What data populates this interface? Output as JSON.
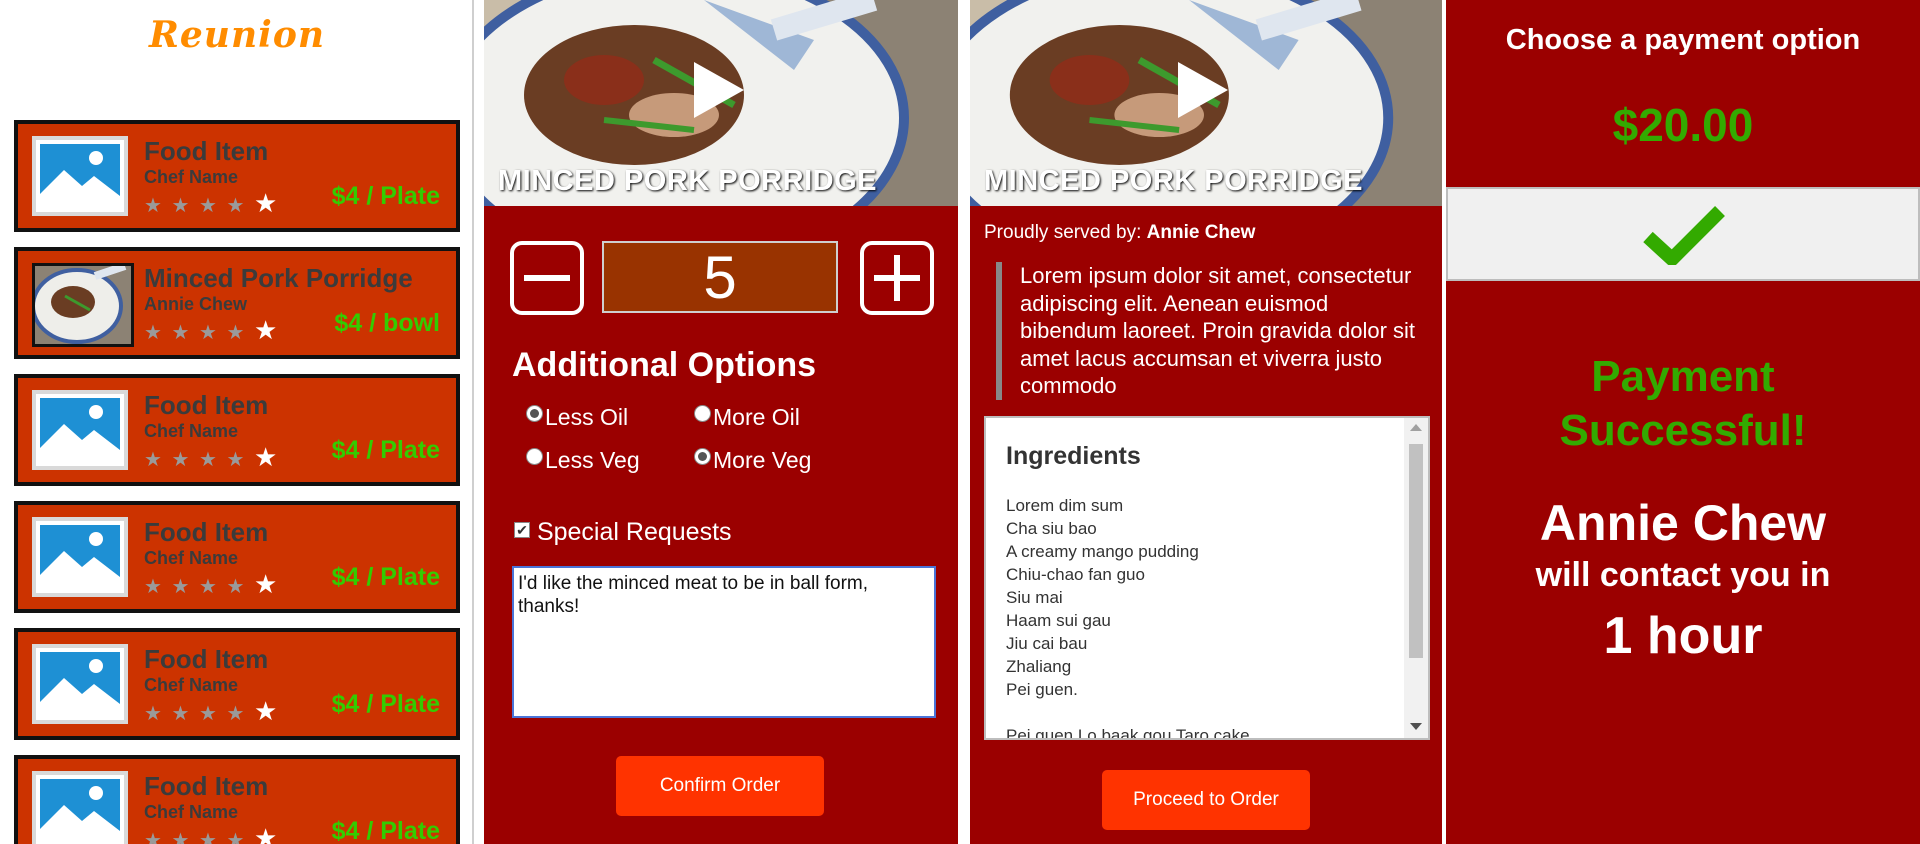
{
  "list_screen": {
    "brand": "Reunion",
    "items": [
      {
        "title": "Food Item",
        "chef": "Chef Name",
        "price": "$4 / Plate",
        "thumbnail": "image-placeholder-icon"
      },
      {
        "title": "Minced Pork Porridge",
        "chef": "Annie Chew",
        "price": "$4 / bowl",
        "thumbnail": "porridge-photo"
      },
      {
        "title": "Food Item",
        "chef": "Chef Name",
        "price": "$4 / Plate",
        "thumbnail": "image-placeholder-icon"
      },
      {
        "title": "Food Item",
        "chef": "Chef Name",
        "price": "$4 / Plate",
        "thumbnail": "image-placeholder-icon"
      },
      {
        "title": "Food Item",
        "chef": "Chef Name",
        "price": "$4 / Plate",
        "thumbnail": "image-placeholder-icon"
      },
      {
        "title": "Food Item",
        "chef": "Chef Name",
        "price": "$4 / Plate",
        "thumbnail": "image-placeholder-icon"
      }
    ],
    "rating_stars": "★ ★ ★ ★",
    "rating_last_star": "★"
  },
  "order_screen": {
    "dish_title": "MINCED PORK PORRIDGE",
    "quantity": "5",
    "options_heading": "Additional Options",
    "options": [
      {
        "label": "Less Oil",
        "selected": true
      },
      {
        "label": "More Oil",
        "selected": false
      },
      {
        "label": "Less Veg",
        "selected": false
      },
      {
        "label": "More Veg",
        "selected": true
      }
    ],
    "special_requests_label": "Special Requests",
    "special_requests_checked": true,
    "special_requests_text": "I'd like the minced meat to be in ball form, thanks!",
    "confirm_label": "Confirm Order"
  },
  "detail_screen": {
    "dish_title": "MINCED PORK PORRIDGE",
    "served_by_prefix": "Proudly served by:",
    "served_by_name": "Annie Chew",
    "description": "Lorem ipsum dolor sit amet, consectetur adipiscing elit. Aenean euismod bibendum laoreet. Proin gravida dolor sit amet lacus accumsan et viverra justo commodo",
    "ingredients_title": "Ingredients",
    "ingredients": [
      "Lorem dim sum",
      "Cha siu bao",
      "A creamy mango pudding",
      "Chiu-chao fan guo",
      "Siu mai",
      "Haam sui gau",
      "Jiu cai bau",
      "Zhaliang",
      "Pei guen.",
      "",
      "Pei guen Lo baak gou Taro cake"
    ],
    "proceed_label": "Proceed to Order"
  },
  "payment_screen": {
    "title": "Choose a payment option",
    "amount": "$20.00",
    "success_line1": "Payment",
    "success_line2": "Successful!",
    "contact_name": "Annie Chew",
    "contact_line": "will contact you in",
    "contact_time": "1 hour"
  },
  "colors": {
    "panel_red": "#9b0000",
    "card_orange": "#cc3300",
    "price_green": "#33cc00",
    "button_red": "#ff3300",
    "brand_orange": "#ff8c00"
  }
}
